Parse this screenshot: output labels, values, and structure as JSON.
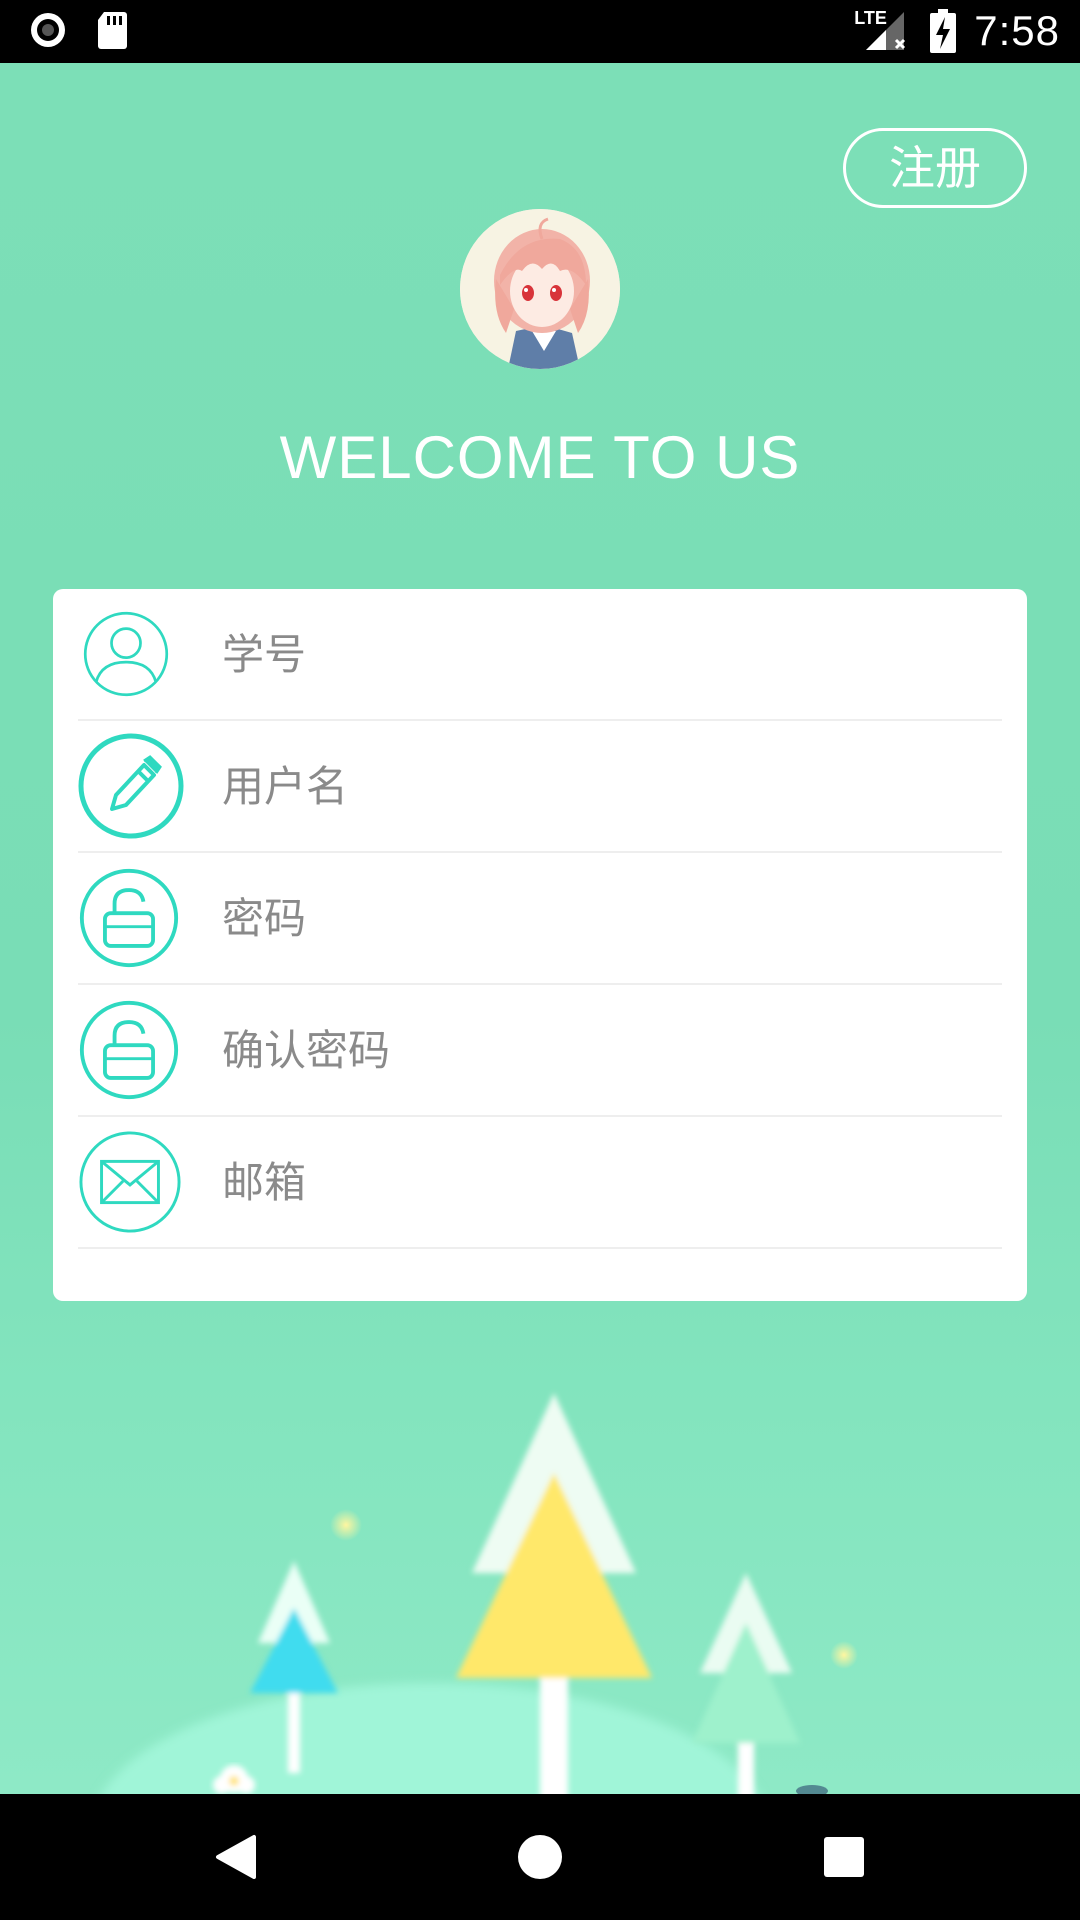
{
  "status_bar": {
    "time": "7:58",
    "network": "LTE",
    "icons": [
      "record-icon",
      "sd-card-icon",
      "signal-icon",
      "battery-charging-icon"
    ]
  },
  "header": {
    "register_label": "注册",
    "welcome_text": "WELCOME TO US"
  },
  "form": {
    "fields": [
      {
        "placeholder": "学号",
        "icon": "user-icon"
      },
      {
        "placeholder": "用户名",
        "icon": "pencil-icon"
      },
      {
        "placeholder": "密码",
        "icon": "unlock-icon"
      },
      {
        "placeholder": "确认密码",
        "icon": "unlock-icon"
      },
      {
        "placeholder": "邮箱",
        "icon": "mail-icon"
      }
    ]
  },
  "colors": {
    "background": "#7cdfb7",
    "accent": "#2fd9c0",
    "card": "#ffffff",
    "placeholder_text": "#888888"
  },
  "nav_bar": {
    "buttons": [
      "back",
      "home",
      "recents"
    ]
  }
}
